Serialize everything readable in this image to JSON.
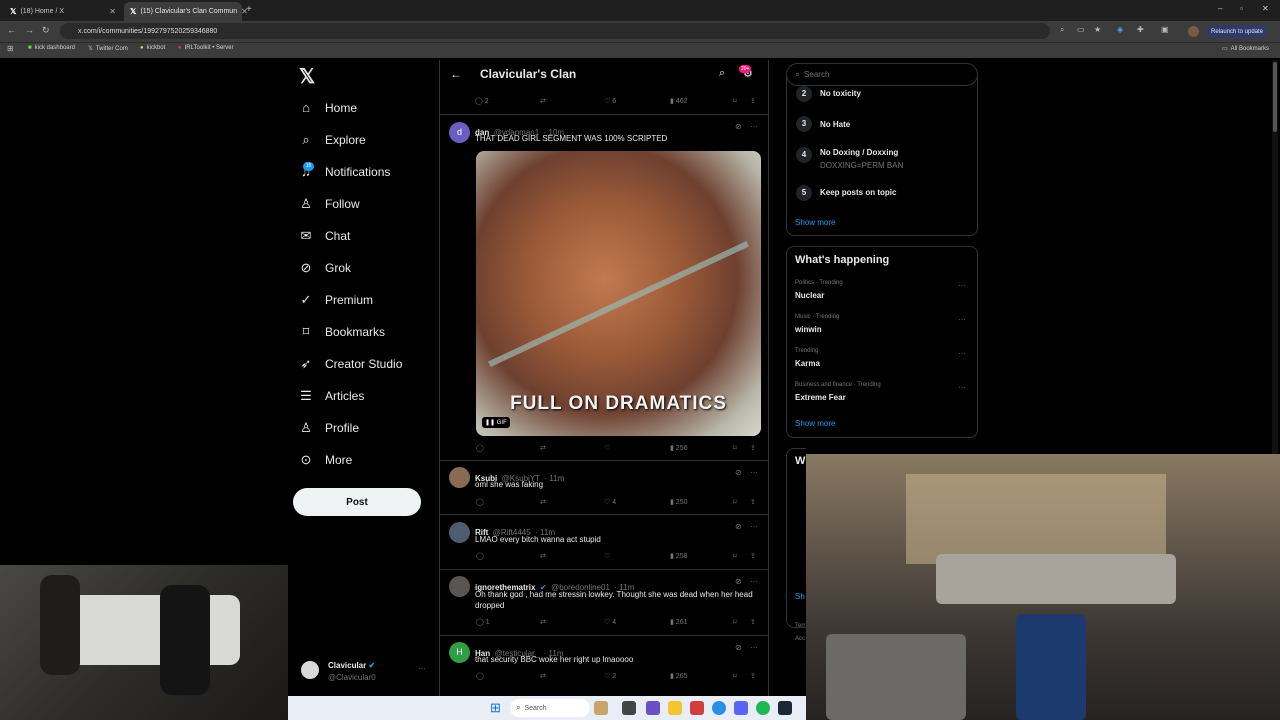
{
  "browser": {
    "tabs": [
      {
        "label": "(18) Home / X"
      },
      {
        "label": "(15) Clavicular's Clan Commun"
      }
    ],
    "new_tab": "+",
    "url": "x.com/i/communities/1992797520259346880",
    "relaunch": "Relaunch to update",
    "bookmarks": [
      "kick dashboard",
      "Twitter Com",
      "kickbot",
      "IRLToolkit • Server"
    ],
    "all_bookmarks": "All Bookmarks",
    "window_controls": [
      "–",
      "▫",
      "✕"
    ]
  },
  "nav": {
    "items": [
      "Home",
      "Explore",
      "Notifications",
      "Follow",
      "Chat",
      "Grok",
      "Premium",
      "Bookmarks",
      "Creator Studio",
      "Articles",
      "Profile",
      "More"
    ],
    "notif_badge": "15",
    "post": "Post",
    "account_name": "Clavicular",
    "account_handle": "@Clavicular0"
  },
  "header": {
    "title": "Clavicular's Clan",
    "badge": "20+"
  },
  "prev_actions": {
    "replies": "2",
    "likes": "6",
    "views": "462"
  },
  "tweets": [
    {
      "initial": "d",
      "name": "dan",
      "handle": "@vdanman1",
      "time": "· 10m",
      "text": "THAT DEAD GIRL SEGMENT WAS 100% SCRIPTED",
      "media_caption": "FULL ON DRAMATICS",
      "gif": "GIF",
      "replies": "",
      "likes": "",
      "views": "256"
    },
    {
      "initial": "",
      "name": "Ksubi",
      "handle": "@KsubiYT",
      "time": "· 11m",
      "text": "oml she was faking",
      "replies": "",
      "likes": "4",
      "views": "250"
    },
    {
      "initial": "",
      "name": "Rift",
      "handle": "@Rift4445",
      "time": "· 11m",
      "text": "LMAO every bitch wanna act stupid",
      "replies": "",
      "likes": "",
      "views": "258"
    },
    {
      "initial": "",
      "name": "ignorethematrix",
      "handle": "@boredonline01",
      "time": "· 11m",
      "text": "Oh thank god , had me stressin lowkey. Thought she was dead when her head dropped",
      "replies": "1",
      "likes": "4",
      "views": "261"
    },
    {
      "initial": "H",
      "name": "Han",
      "handle": "@testicular_",
      "time": "· 11m",
      "text": "that security BBC woke her right up lmaoooo",
      "replies": "",
      "likes": "2",
      "views": "265"
    }
  ],
  "right": {
    "search_placeholder": "Search",
    "rules": [
      {
        "n": "2",
        "t": "No toxicity",
        "s": ""
      },
      {
        "n": "3",
        "t": "No Hate",
        "s": ""
      },
      {
        "n": "4",
        "t": "No Doxing / Doxxing",
        "s": "DOXXING=PERM BAN"
      },
      {
        "n": "5",
        "t": "Keep posts on topic",
        "s": ""
      }
    ],
    "show_more": "Show more",
    "happening_title": "What's happening",
    "trends": [
      {
        "cat": "Politics · Trending",
        "name": "Nuclear"
      },
      {
        "cat": "Music · Trending",
        "name": "winwin"
      },
      {
        "cat": "Trending",
        "name": "Karma"
      },
      {
        "cat": "Business and finance · Trending",
        "name": "Extreme Fear"
      }
    ],
    "show_more2": "Show more",
    "who_partial": "W",
    "show_partial": "Sh",
    "terms_partial": "Terr",
    "acc_partial": "Acc"
  },
  "taskbar": {
    "search": "Search"
  },
  "colors": {
    "accent": "#1d9bf0",
    "bg": "#000000",
    "border": "#2f3336",
    "muted": "#71767b"
  }
}
